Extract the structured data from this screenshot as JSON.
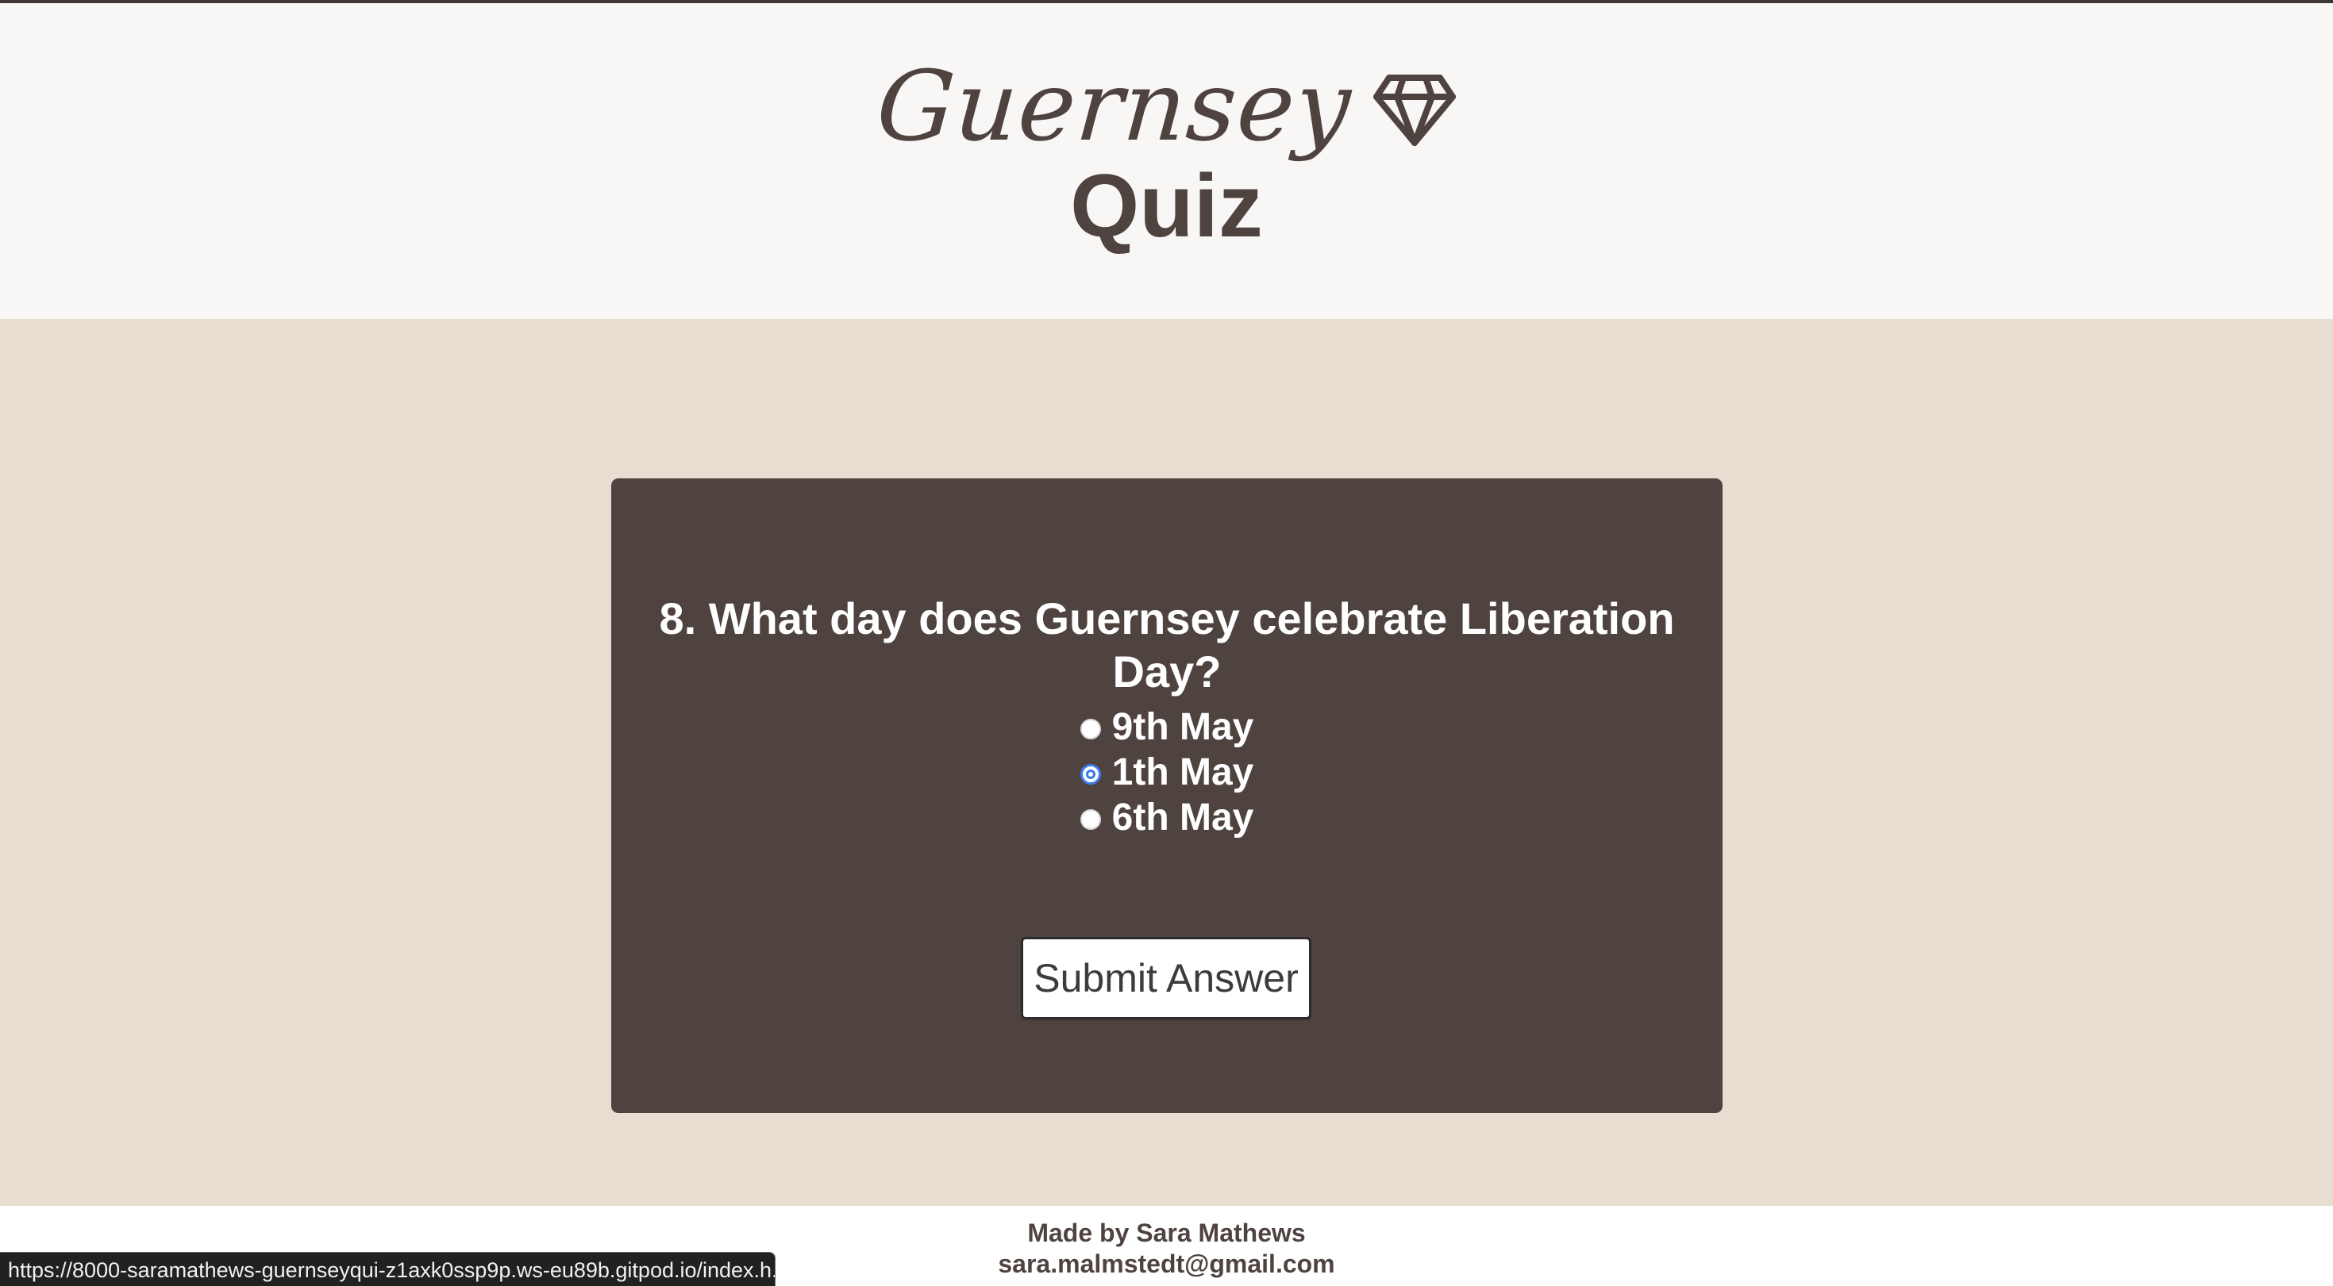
{
  "header": {
    "brand_name": "Guernsey",
    "brand_icon": "gem-icon",
    "title": "Quiz"
  },
  "quiz": {
    "question": "8. What day does Guernsey celebrate Liberation Day?",
    "options": [
      {
        "label": "9th May",
        "selected": false
      },
      {
        "label": "1th May",
        "selected": true
      },
      {
        "label": "6th May",
        "selected": false
      }
    ],
    "submit_label": "Submit Answer"
  },
  "footer": {
    "credit": "Made by Sara Mathews",
    "email": "sara.malmstedt@gmail.com"
  },
  "status_bar": {
    "url": "https://8000-saramathews-guernseyqui-z1axk0ssp9p.ws-eu89b.gitpod.io/index.h..."
  },
  "colors": {
    "brand_dark": "#4f4340",
    "page_bg": "#e8ddd1",
    "header_bg": "#f8f7f5",
    "radio_accent": "#3a7cf0"
  }
}
